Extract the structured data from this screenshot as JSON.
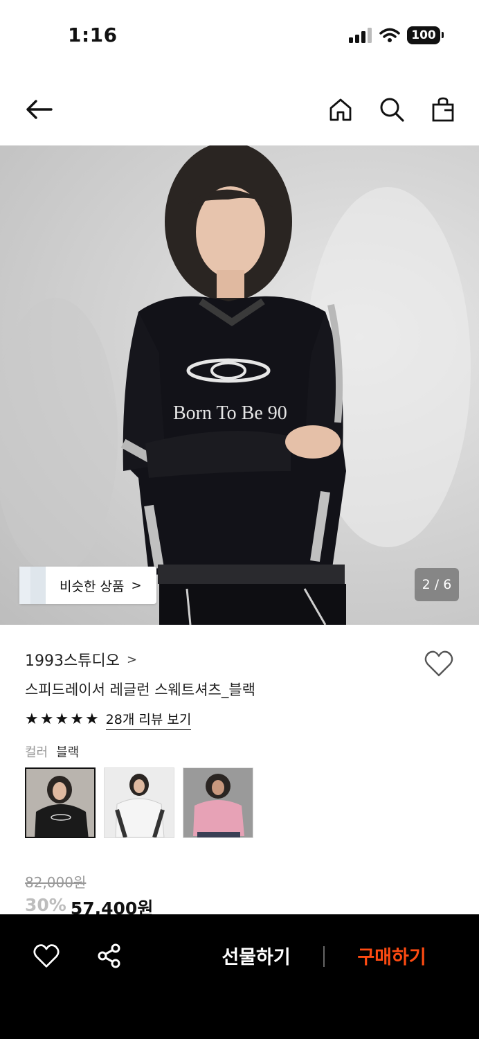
{
  "status": {
    "time": "1:16",
    "battery": "100"
  },
  "nav": {
    "back_icon": "arrow-left-icon",
    "home_icon": "home-icon",
    "search_icon": "search-icon",
    "bag_icon": "shopping-bag-icon"
  },
  "gallery": {
    "similar_label": "비슷한 상품",
    "similar_arrow": ">",
    "counter": "2 / 6"
  },
  "product": {
    "brand": "1993스튜디오",
    "brand_chevron": ">",
    "name": "스피드레이서 레글런 스웨트셔츠_블랙",
    "rating_stars": 5,
    "review_link": "28개 리뷰 보기",
    "color_label": "컬러",
    "color_value": "블랙",
    "colors": [
      {
        "name": "블랙",
        "hex": "#1a1a1a",
        "selected": true
      },
      {
        "name": "화이트",
        "hex": "#f0f0f0",
        "selected": false
      },
      {
        "name": "핑크",
        "hex": "#e7a2b6",
        "selected": false
      }
    ],
    "original_price": "82,000원",
    "discount": "30%",
    "final_price": "57,400원"
  },
  "bottom_bar": {
    "gift_label": "선물하기",
    "buy_label": "구매하기",
    "accent": "#ff4b12"
  }
}
